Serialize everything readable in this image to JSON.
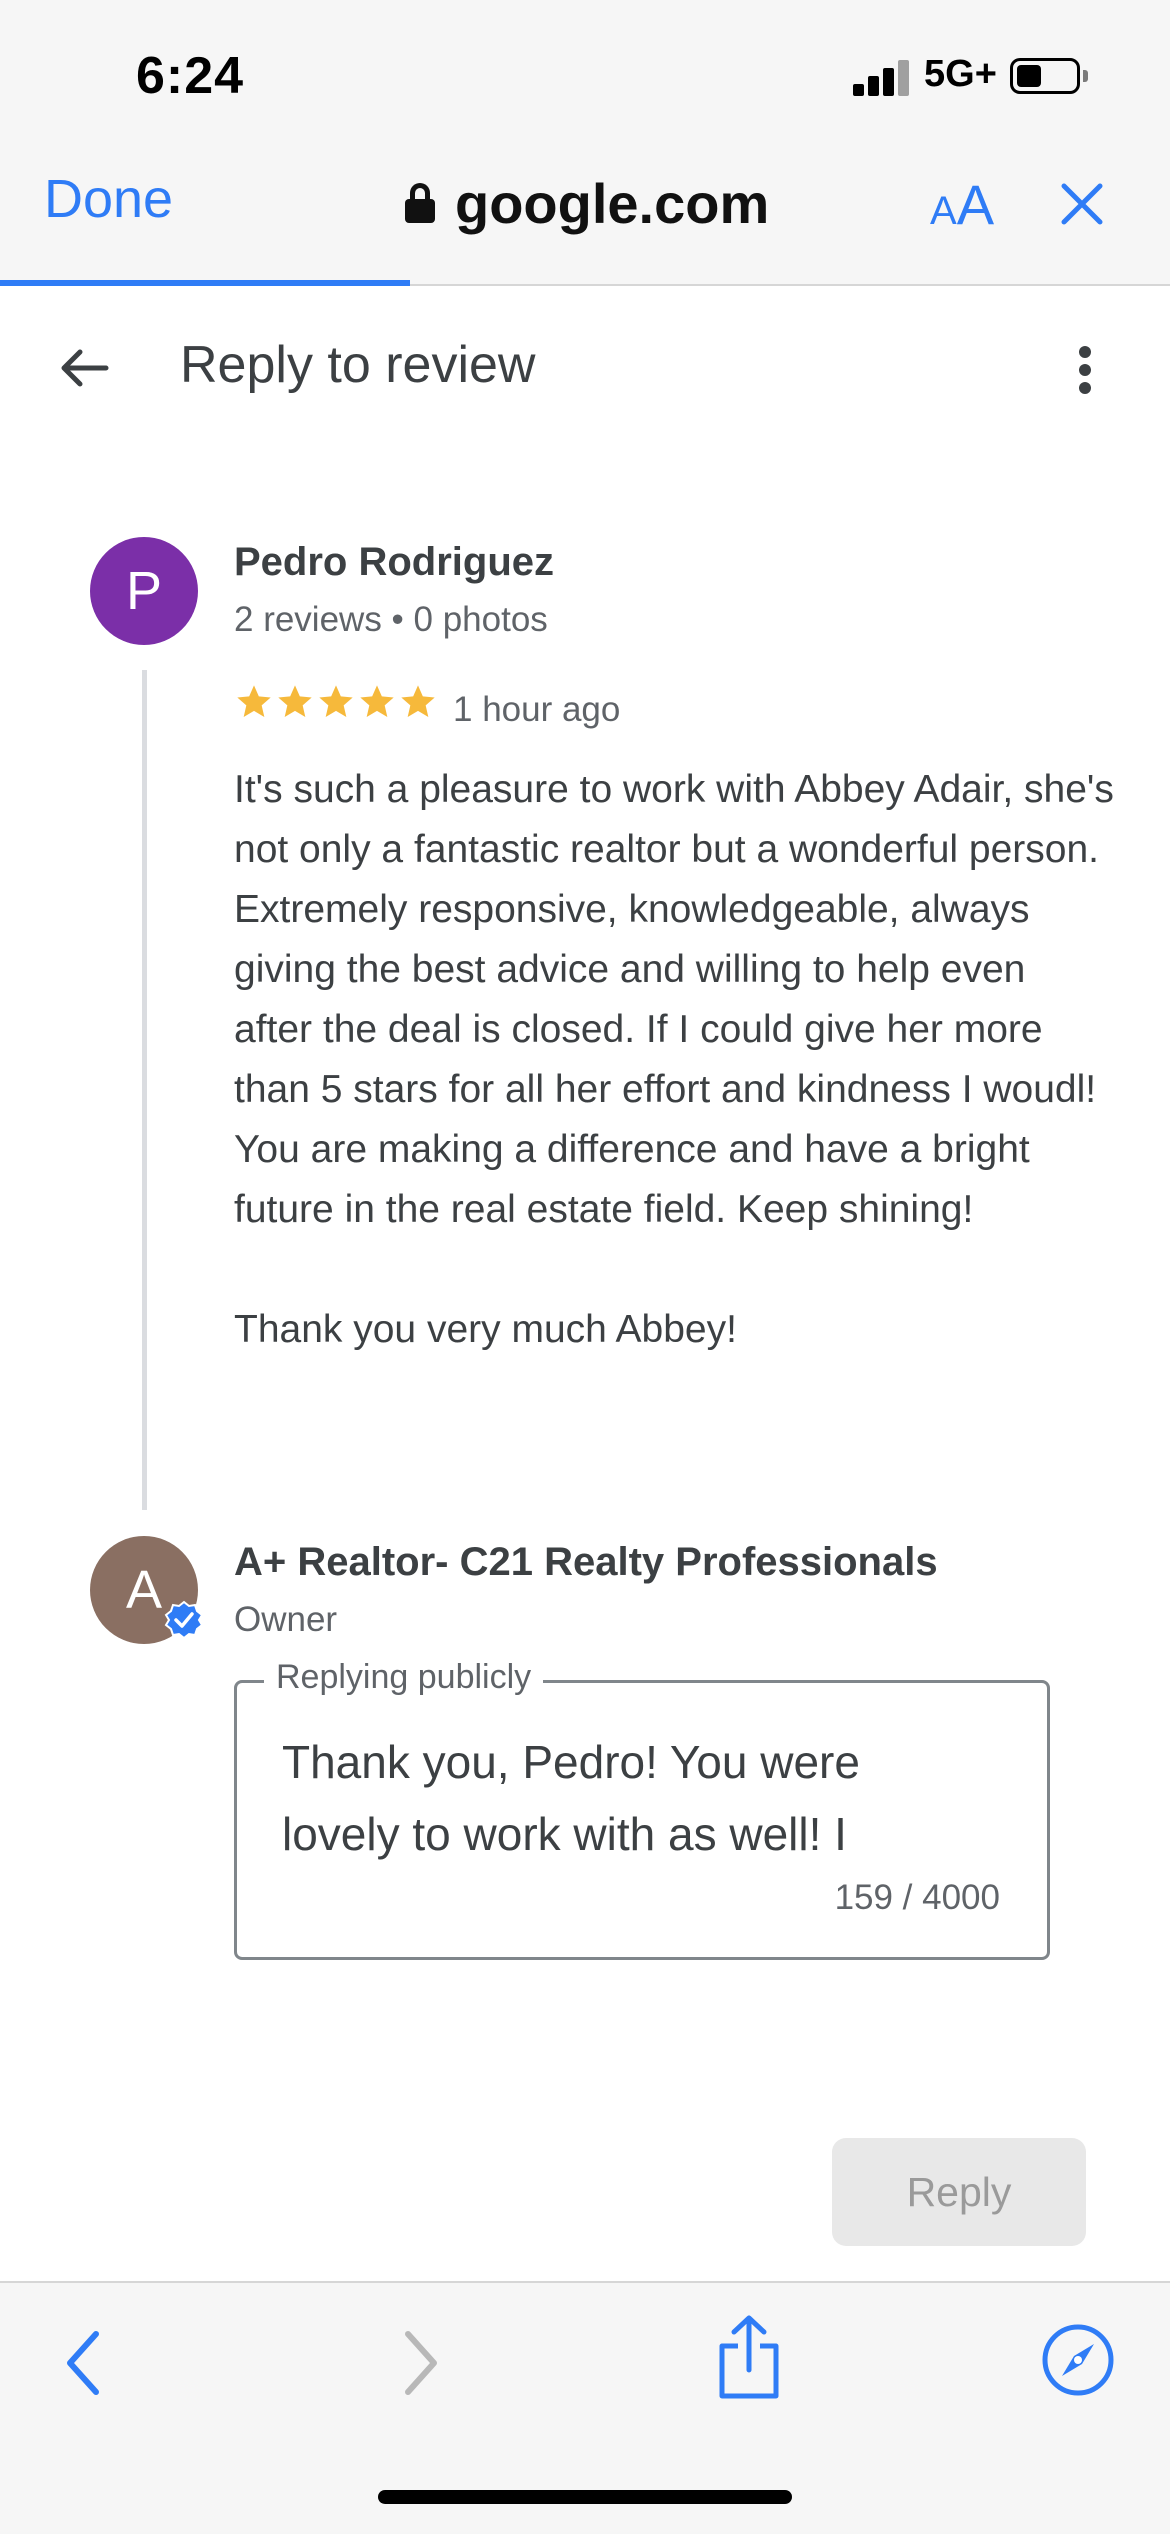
{
  "status_bar": {
    "time": "6:24",
    "network": "5G+"
  },
  "browser": {
    "done_label": "Done",
    "url": "google.com",
    "text_size_small": "A",
    "text_size_big": "A",
    "accent_color": "#2f7cf6"
  },
  "header": {
    "title": "Reply to review"
  },
  "review": {
    "avatar_letter": "P",
    "avatar_color": "#7b2fa8",
    "reviewer_name": "Pedro Rodriguez",
    "reviewer_meta": "2 reviews • 0 photos",
    "rating": 5,
    "time_ago": "1 hour ago",
    "text": "It's such a pleasure to work with Abbey Adair, she's not only a fantastic realtor but a wonderful person. Extremely responsive, knowledgeable, always giving the best advice and willing to help even after the deal is closed. If I could give her more than 5 stars for all her effort and kindness I woudl!\nYou are making a difference and have a bright future in the real estate field. Keep shining!\n\nThank you very much Abbey!"
  },
  "owner": {
    "avatar_letter": "A",
    "avatar_color": "#8a6f62",
    "name": "A+ Realtor- C21 Realty Professionals",
    "role": "Owner"
  },
  "reply": {
    "label": "Replying publicly",
    "text": "Thank you, Pedro! You were lovely to work with as well! I",
    "char_count": "159 / 4000",
    "button_label": "Reply"
  }
}
